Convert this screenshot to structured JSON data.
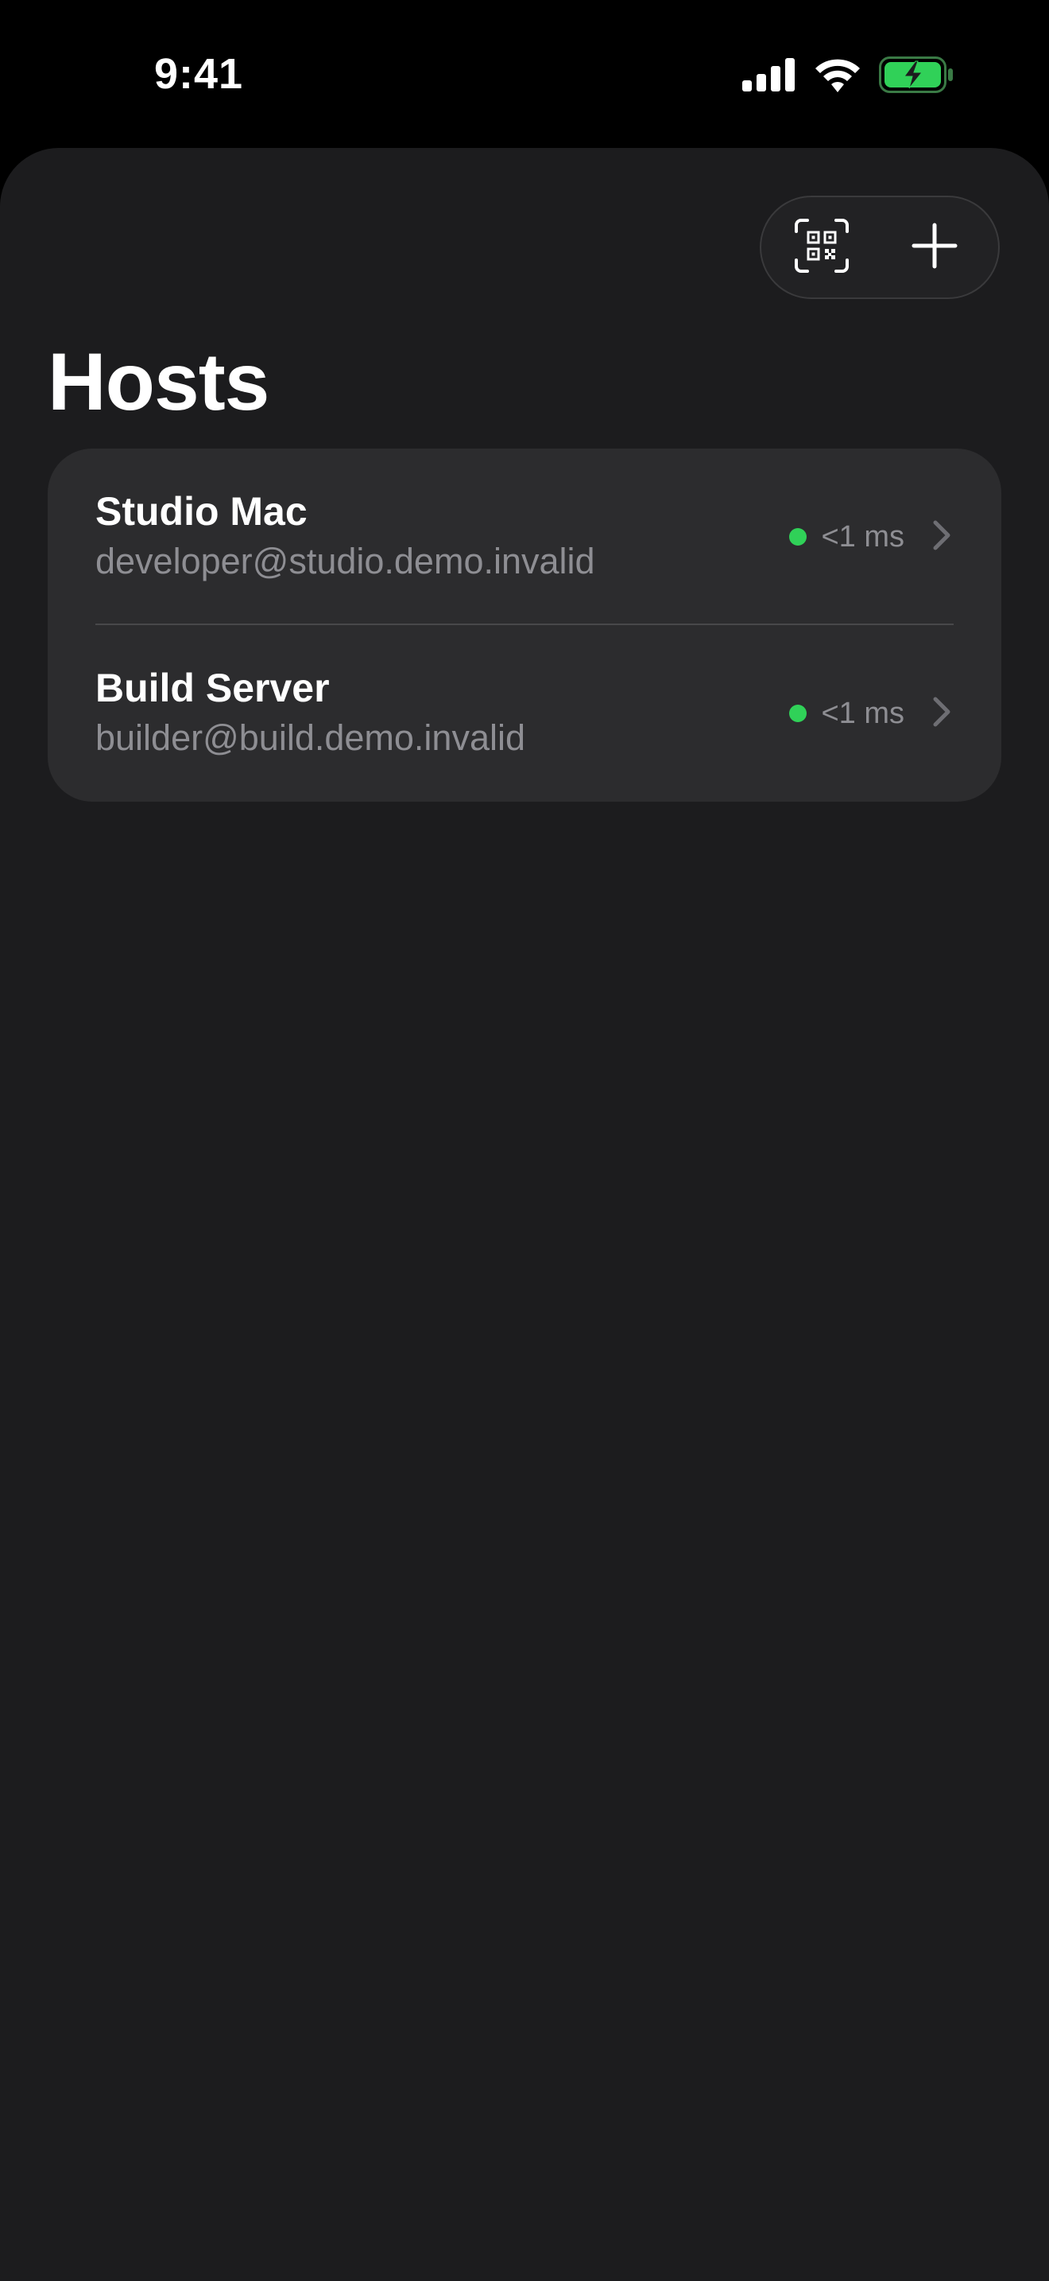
{
  "status_bar": {
    "time": "9:41"
  },
  "toolbar": {
    "scan_icon": "qr-code-scan-icon",
    "add_icon": "plus-icon"
  },
  "page": {
    "title": "Hosts"
  },
  "hosts": [
    {
      "name": "Studio Mac",
      "address": "developer@studio.demo.invalid",
      "latency": "<1 ms",
      "status": "online"
    },
    {
      "name": "Build Server",
      "address": "builder@build.demo.invalid",
      "latency": "<1 ms",
      "status": "online"
    }
  ],
  "colors": {
    "background": "#000000",
    "sheet": "#1c1c1e",
    "card": "#2c2c2e",
    "online": "#30d158",
    "secondary_text": "#8e8e93",
    "battery": "#30d158"
  }
}
